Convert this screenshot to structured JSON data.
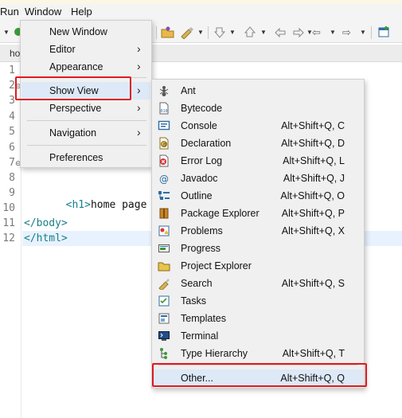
{
  "menubar": {
    "items": [
      "Run",
      "Window",
      "Help"
    ]
  },
  "editor": {
    "tab_label": "ho",
    "line_numbers": [
      "1",
      "2",
      "3",
      "4",
      "5",
      "6",
      "7",
      "8",
      "9",
      "10",
      "11",
      "12"
    ],
    "fold_markers": {
      "line2": "⊖",
      "line7": "⊖"
    },
    "code": {
      "line9_tag": "<h1>",
      "line9_text": "home page",
      "line11": "</body>",
      "line12": "</html>"
    }
  },
  "window_menu": {
    "items": [
      {
        "label": "New Window",
        "submenu": false
      },
      {
        "label": "Editor",
        "submenu": true
      },
      {
        "label": "Appearance",
        "submenu": true
      },
      {
        "label": "Show View",
        "submenu": true
      },
      {
        "label": "Perspective",
        "submenu": true
      },
      {
        "label": "Navigation",
        "submenu": true
      },
      {
        "label": "Preferences",
        "submenu": false
      }
    ],
    "highlighted": "Show View",
    "submenu_arrow": "›"
  },
  "show_view_menu": {
    "items": [
      {
        "label": "Ant",
        "shortcut": "",
        "icon": "ant-icon"
      },
      {
        "label": "Bytecode",
        "shortcut": "",
        "icon": "bytecode-icon"
      },
      {
        "label": "Console",
        "shortcut": "Alt+Shift+Q, C",
        "icon": "console-icon"
      },
      {
        "label": "Declaration",
        "shortcut": "Alt+Shift+Q, D",
        "icon": "declaration-icon"
      },
      {
        "label": "Error Log",
        "shortcut": "Alt+Shift+Q, L",
        "icon": "error-log-icon"
      },
      {
        "label": "Javadoc",
        "shortcut": "Alt+Shift+Q, J",
        "icon": "javadoc-icon"
      },
      {
        "label": "Outline",
        "shortcut": "Alt+Shift+Q, O",
        "icon": "outline-icon"
      },
      {
        "label": "Package Explorer",
        "shortcut": "Alt+Shift+Q, P",
        "icon": "package-explorer-icon"
      },
      {
        "label": "Problems",
        "shortcut": "Alt+Shift+Q, X",
        "icon": "problems-icon"
      },
      {
        "label": "Progress",
        "shortcut": "",
        "icon": "progress-icon"
      },
      {
        "label": "Project Explorer",
        "shortcut": "",
        "icon": "project-explorer-icon"
      },
      {
        "label": "Search",
        "shortcut": "Alt+Shift+Q, S",
        "icon": "search-icon"
      },
      {
        "label": "Tasks",
        "shortcut": "",
        "icon": "tasks-icon"
      },
      {
        "label": "Templates",
        "shortcut": "",
        "icon": "templates-icon"
      },
      {
        "label": "Terminal",
        "shortcut": "",
        "icon": "terminal-icon"
      },
      {
        "label": "Type Hierarchy",
        "shortcut": "Alt+Shift+Q, T",
        "icon": "type-hierarchy-icon"
      },
      {
        "label": "Other...",
        "shortcut": "Alt+Shift+Q, Q",
        "icon": ""
      }
    ],
    "highlighted": "Other..."
  },
  "colors": {
    "highlight_box": "#e0191e",
    "menu_hover": "#dde9f7",
    "tag_color": "#17808a"
  }
}
